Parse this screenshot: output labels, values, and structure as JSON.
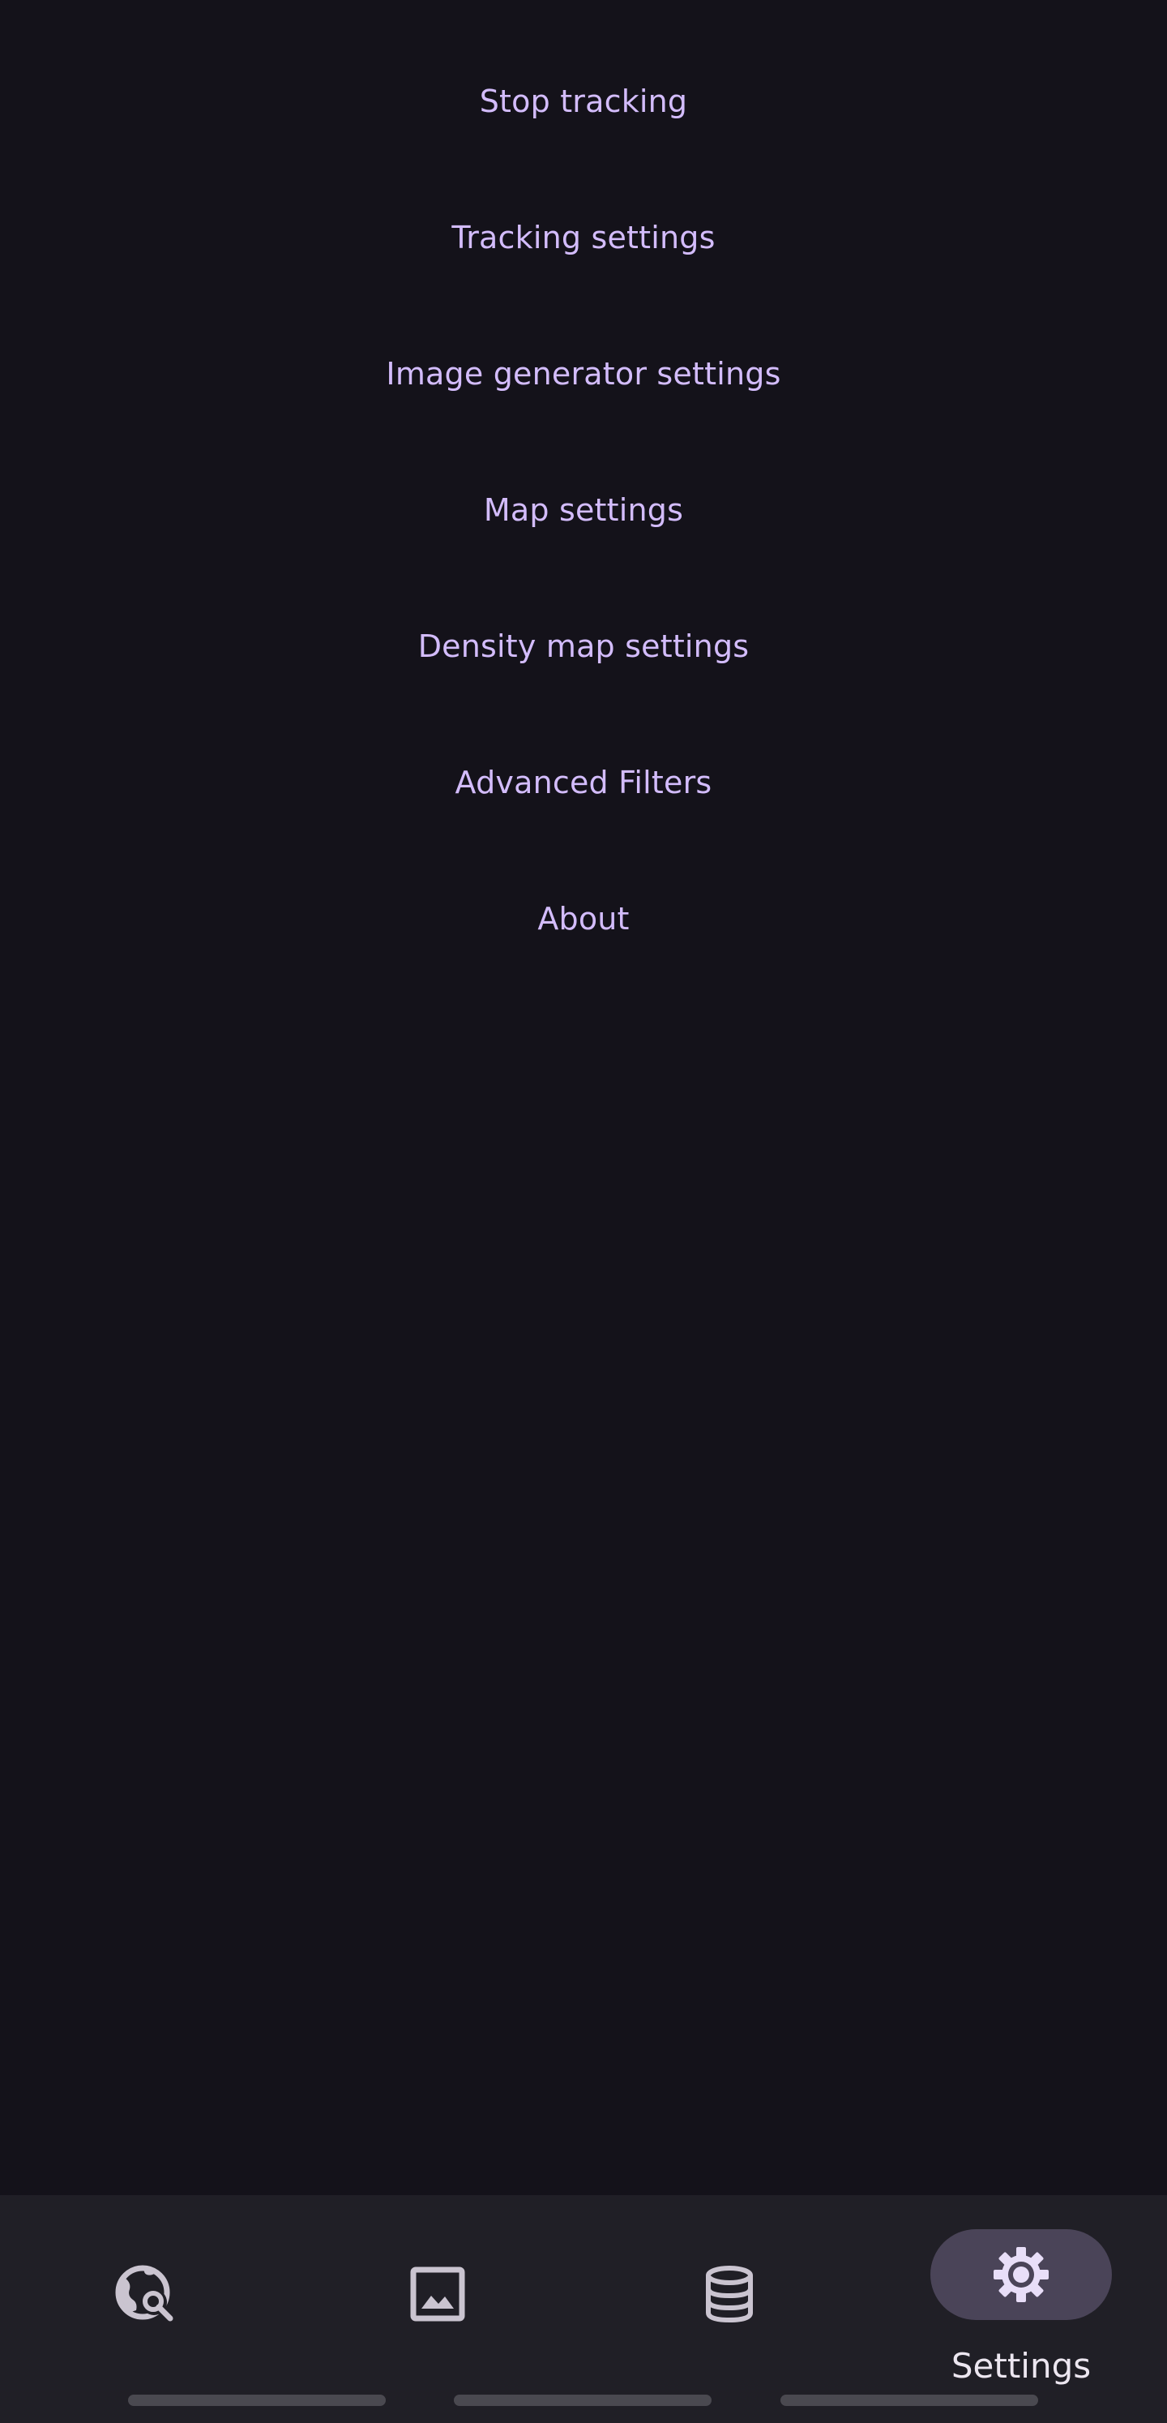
{
  "menu": {
    "items": [
      {
        "label": "Stop tracking"
      },
      {
        "label": "Tracking settings"
      },
      {
        "label": "Image generator settings"
      },
      {
        "label": "Map settings"
      },
      {
        "label": "Density map settings"
      },
      {
        "label": "Advanced Filters"
      },
      {
        "label": "About"
      }
    ]
  },
  "bottom_nav": {
    "items": [
      {
        "icon": "globe-search-icon",
        "label": ""
      },
      {
        "icon": "image-icon",
        "label": ""
      },
      {
        "icon": "database-icon",
        "label": ""
      },
      {
        "icon": "gear-icon",
        "label": "Settings",
        "active": true
      }
    ]
  },
  "colors": {
    "background": "#14121a",
    "menu_text": "#d3bcfc",
    "nav_background": "#201f26",
    "nav_active_pill": "#4a4458",
    "nav_icon": "#cac4d0",
    "nav_active_icon": "#e8def8"
  }
}
